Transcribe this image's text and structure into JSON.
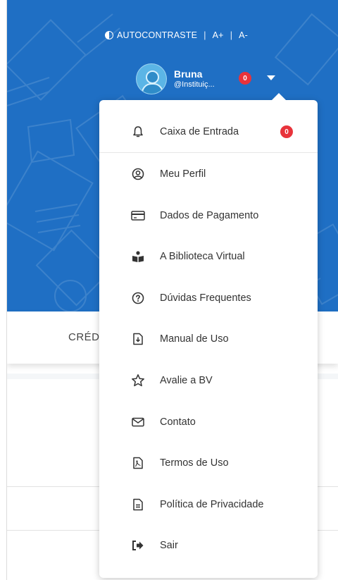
{
  "accessibility": {
    "contrast_label": "AUTOCONTRASTE",
    "font_increase": "A+",
    "font_decrease": "A-",
    "separator": "|"
  },
  "user": {
    "name": "Bruna",
    "handle": "@Instituiç...",
    "notification_count": "0"
  },
  "tab": {
    "label": "CRÉD"
  },
  "menu": {
    "items": [
      {
        "label": "Caixa de Entrada",
        "icon": "bell-icon",
        "badge": "0"
      },
      {
        "label": "Meu Perfil",
        "icon": "user-circle-icon"
      },
      {
        "label": "Dados de Pagamento",
        "icon": "credit-card-icon"
      },
      {
        "label": "A Biblioteca Virtual",
        "icon": "reader-book-icon"
      },
      {
        "label": "Dúvidas Frequentes",
        "icon": "question-circle-icon"
      },
      {
        "label": "Manual de Uso",
        "icon": "file-download-icon"
      },
      {
        "label": "Avalie a BV",
        "icon": "star-icon"
      },
      {
        "label": "Contato",
        "icon": "envelope-icon"
      },
      {
        "label": "Termos de Uso",
        "icon": "file-pdf-icon"
      },
      {
        "label": "Política de Privacidade",
        "icon": "file-text-icon"
      },
      {
        "label": "Sair",
        "icon": "sign-out-icon"
      }
    ]
  },
  "colors": {
    "header_blue": "#1f6fc4",
    "badge_red": "#e8333b",
    "text_dark": "#333333"
  }
}
